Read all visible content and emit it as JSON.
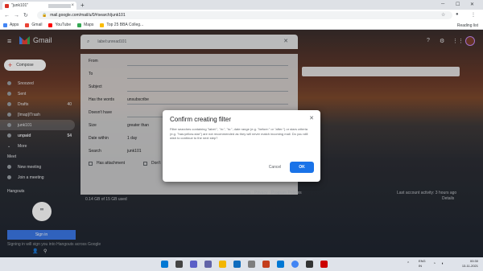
{
  "browser": {
    "tab_title": "\"junk101\"",
    "tab_close": "×",
    "new_tab": "+",
    "url": "mail.google.com/mail/u/0/#search/junk101",
    "bookmarks": [
      "Apps",
      "Gmail",
      "YouTube",
      "Maps",
      "Top 25 BBA Colleg..."
    ],
    "reading_list": "Reading list"
  },
  "gmail": {
    "brand": "Gmail",
    "search_query": "label:unread101",
    "compose": "Compose",
    "sidebar": [
      {
        "label": "Snoozed",
        "count": ""
      },
      {
        "label": "Sent",
        "count": ""
      },
      {
        "label": "Drafts",
        "count": "40"
      },
      {
        "label": "[Imap]/Trash",
        "count": ""
      },
      {
        "label": "junk101",
        "count": ""
      },
      {
        "label": "unpaid",
        "count": "54"
      },
      {
        "label": "More",
        "count": ""
      }
    ],
    "meet_label": "Meet",
    "meet_items": [
      "New meeting",
      "Join a meeting"
    ],
    "hangouts_label": "Hangouts",
    "hangouts_bubble": "\"",
    "signin": "Sign in",
    "signin_note": "Signing in will sign you into Hangouts across Google"
  },
  "search_panel": {
    "from_label": "From",
    "to_label": "To",
    "subject_label": "Subject",
    "has_words_label": "Has the words",
    "has_words_value": "unsubscribe",
    "doesnt_have_label": "Doesn't have",
    "size_label": "Size",
    "size_value": "greater than",
    "date_label": "Date within",
    "date_value": "1 day",
    "search_label": "Search",
    "search_value": "junk101",
    "has_attachment": "Has attachment",
    "dont_include": "Don't"
  },
  "footer": {
    "storage": "0.14 GB of 15 GB used",
    "links": "Terms · Privacy · Program Policies",
    "activity": "Last account activity: 3 hours ago",
    "details": "Details"
  },
  "modal": {
    "title": "Confirm creating filter",
    "body": "Filter searches containing \"label:\", \"in:\", \"is:\", date range (e.g. \"before:\" or \"after:\") or stars criteria (e.g. \"has:yellow-star\") are not recommended as they will never match incoming mail. Do you still wish to continue to the next step?",
    "cancel": "Cancel",
    "ok": "OK"
  },
  "taskbar": {
    "lang_top": "ENG",
    "lang_bottom": "IN",
    "time": "00:30",
    "date": "13-11-2021"
  }
}
